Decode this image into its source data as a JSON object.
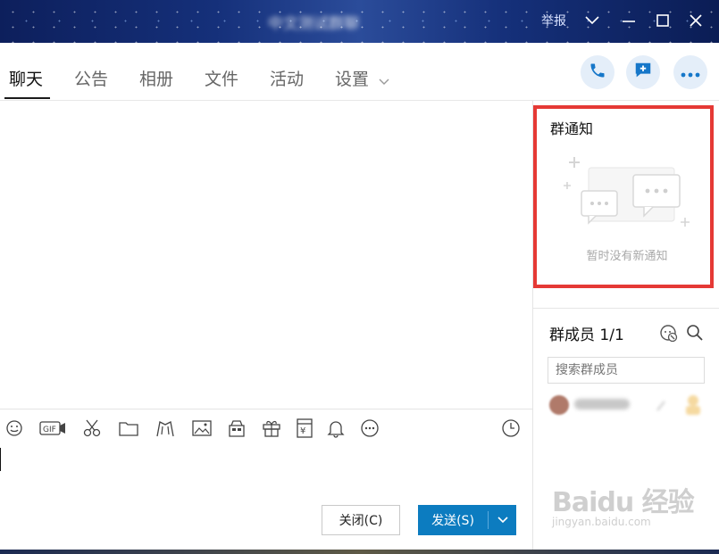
{
  "titlebar": {
    "group_name": "中文测试群聊",
    "report_label": "举报"
  },
  "tabs": [
    {
      "label": "聊天",
      "active": true
    },
    {
      "label": "公告"
    },
    {
      "label": "相册"
    },
    {
      "label": "文件"
    },
    {
      "label": "活动"
    },
    {
      "label": "设置"
    }
  ],
  "toolbar_icons": [
    "emoji-icon",
    "gif-icon",
    "screenshot-scissors-icon",
    "folder-icon",
    "doodle-icon",
    "image-icon",
    "sticker-icon",
    "gift-icon",
    "red-packet-icon",
    "bell-icon",
    "more-icon",
    "history-clock-icon"
  ],
  "buttons": {
    "close_label": "关闭(C)",
    "send_label": "发送(S)"
  },
  "notice": {
    "title": "群通知",
    "empty_text": "暂时没有新通知"
  },
  "members": {
    "title": "群成员 1/1",
    "search_placeholder": "搜索群成员"
  },
  "watermark": {
    "line1": "Baidu 经验",
    "line2": "jingyan.baidu.com"
  },
  "colors": {
    "accent": "#0c7cc0",
    "highlight_box": "#e53935"
  }
}
